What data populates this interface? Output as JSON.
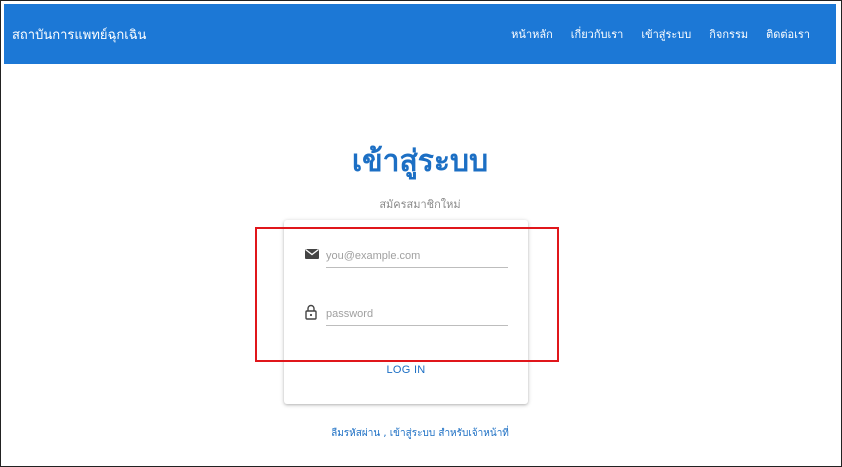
{
  "navbar": {
    "brand": "สถาบันการแพทย์ฉุกเฉิน",
    "links": [
      "หน้าหลัก",
      "เกี่ยวกับเรา",
      "เข้าสู่ระบบ",
      "กิจกรรม",
      "ติดต่อเรา"
    ],
    "color": "#1c78d6"
  },
  "main": {
    "title": "เข้าสู่ระบบ",
    "signup_link": "สมัครสมาชิกใหม่"
  },
  "form": {
    "email_placeholder": "you@example.com",
    "email_icon": "envelope-icon",
    "password_placeholder": "password",
    "password_icon": "lock-icon",
    "login_button": "LOG IN"
  },
  "footer": {
    "forgot_password": "ลืมรหัสผ่าน",
    "separator": ",",
    "staff_login": "เข้าสู่ระบบ สำหรับเจ้าหน้าที่"
  },
  "highlight_color": "#e0161b"
}
